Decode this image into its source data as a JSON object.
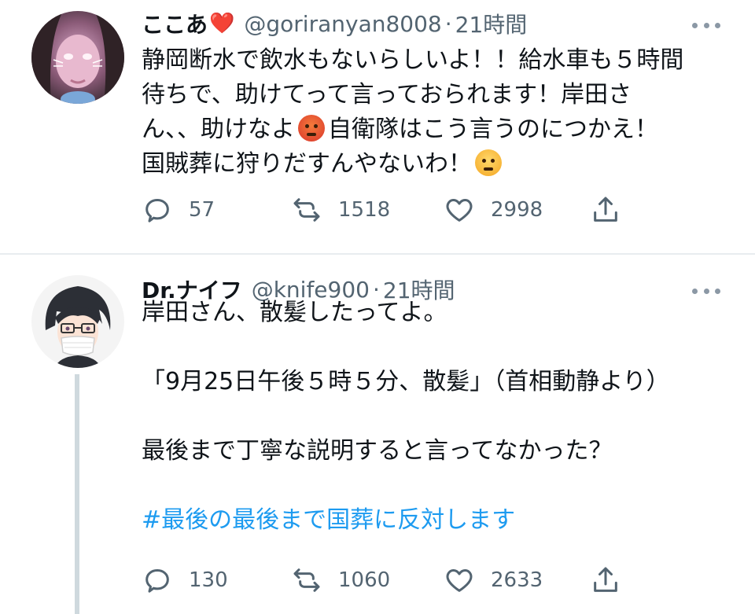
{
  "tweets": [
    {
      "display_name": "ここあ",
      "name_emoji": "❤️",
      "handle": "@goriranyan8008",
      "separator": "·",
      "time": "21時間",
      "lines": [
        "静岡断水で飲水もないらしいよ！！給水車も５時間",
        "待ちで、助けてって言っておられます！岸田さ",
        "ん、、助けなよ",
        "自衛隊はこう言うのにつかえ！",
        "国賊葬に狩りだすんやないわ！"
      ],
      "emojis": [
        "angry-face-emoji",
        "face-with-steam-emoji"
      ],
      "reply_count": "57",
      "retweet_count": "1518",
      "like_count": "2998"
    },
    {
      "display_name": "Dr.ナイフ",
      "handle": "@knife900",
      "separator": "·",
      "time": "21時間",
      "lines": [
        "岸田さん、散髪したってよ。",
        "「9月25日午後５時５分、散髪」（首相動静より）",
        "最後まで丁寧な説明すると言ってなかった？"
      ],
      "hashtag": "#最後の最後まで国葬に反対します",
      "reply_count": "130",
      "retweet_count": "1060",
      "like_count": "2633"
    }
  ],
  "icons": {
    "reply": "reply-icon",
    "retweet": "retweet-icon",
    "like": "heart-icon",
    "share": "share-icon",
    "more": "more-icon"
  },
  "colors": {
    "text": "#0f1419",
    "secondary": "#536471",
    "link": "#1d9bf0",
    "divider": "#e8ecef",
    "thread_line": "#cfd9de",
    "heart": "#e0242b"
  }
}
